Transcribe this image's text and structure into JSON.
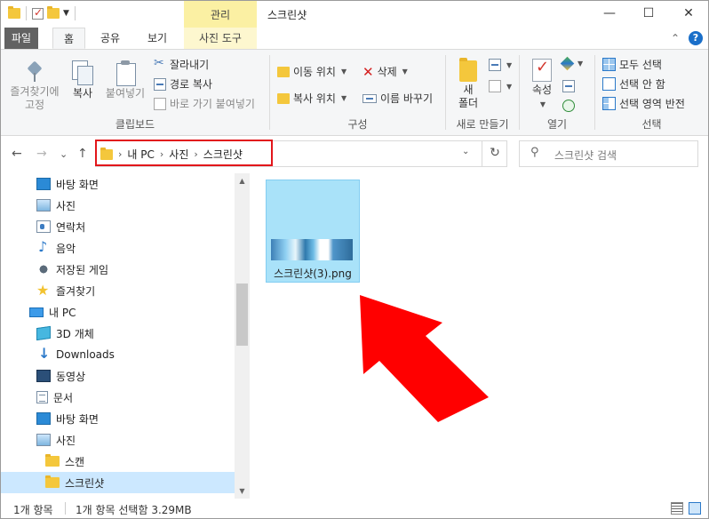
{
  "window": {
    "title": "스크린샷",
    "context_tab_header": "관리",
    "controls": {
      "minimize": "—",
      "maximize": "☐",
      "close": "✕"
    }
  },
  "ribbon_tabs": [
    "파일",
    "홈",
    "공유",
    "보기",
    "사진 도구"
  ],
  "ribbon_right": {
    "collapse": "⌃",
    "help": "?"
  },
  "groups": {
    "clipboard": {
      "label": "클립보드",
      "pin": "즐겨찾기에\n고정",
      "copy": "복사",
      "paste": "붙여넣기",
      "cut": "잘라내기",
      "copy_path": "경로 복사",
      "paste_shortcut": "바로 가기 붙여넣기"
    },
    "organize": {
      "label": "구성",
      "move_to": "이동 위치",
      "copy_to": "복사 위치",
      "delete": "삭제",
      "rename": "이름 바꾸기"
    },
    "new": {
      "label": "새로 만들기",
      "new_folder_line1": "새",
      "new_folder_line2": "폴더"
    },
    "open": {
      "label": "열기",
      "properties": "속성"
    },
    "select": {
      "label": "선택",
      "select_all": "모두 선택",
      "select_none": "선택 안 함",
      "invert": "선택 영역 반전"
    }
  },
  "address": {
    "crumbs": [
      "내 PC",
      "사진",
      "스크린샷"
    ],
    "search_placeholder": "스크린샷 검색"
  },
  "nav_arrows": {
    "back": "←",
    "forward": "→",
    "recent": "⌄",
    "up": "↑",
    "refresh": "↻",
    "dropdown": "⌄",
    "search": "⚲"
  },
  "tree": [
    {
      "label": "바탕 화면",
      "icon": "desktop-icon"
    },
    {
      "label": "사진",
      "icon": "pictures-icon"
    },
    {
      "label": "연락처",
      "icon": "contacts-icon"
    },
    {
      "label": "음악",
      "icon": "music-icon"
    },
    {
      "label": "저장된 게임",
      "icon": "saved-games-icon"
    },
    {
      "label": "즐겨찾기",
      "icon": "favorites-icon"
    },
    {
      "label": "내 PC",
      "icon": "pc-icon"
    },
    {
      "label": "3D 개체",
      "icon": "3d-objects-icon"
    },
    {
      "label": "Downloads",
      "icon": "downloads-icon"
    },
    {
      "label": "동영상",
      "icon": "videos-icon"
    },
    {
      "label": "문서",
      "icon": "documents-icon"
    },
    {
      "label": "바탕 화면",
      "icon": "desktop-icon"
    },
    {
      "label": "사진",
      "icon": "pictures-icon"
    },
    {
      "label": "스캔",
      "icon": "folder-icon"
    },
    {
      "label": "스크린샷",
      "icon": "folder-icon"
    }
  ],
  "file": {
    "name": "스크린샷(3).png"
  },
  "status": {
    "count": "1개 항목",
    "selected": "1개 항목 선택함 3.29MB"
  },
  "colors": {
    "highlight": "#e2161b",
    "arrow": "#ff0000",
    "selection": "#a9e2f9",
    "context_tab": "#fbf0a3"
  }
}
